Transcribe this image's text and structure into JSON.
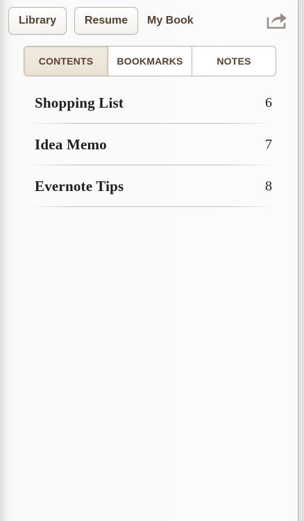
{
  "toolbar": {
    "library_label": "Library",
    "resume_label": "Resume",
    "book_title": "My Book",
    "share_icon": "share-arrow-icon"
  },
  "tabs": [
    {
      "label": "CONTENTS",
      "active": true
    },
    {
      "label": "BOOKMARKS",
      "active": false
    },
    {
      "label": "NOTES",
      "active": false
    }
  ],
  "contents": [
    {
      "title": "Shopping List",
      "page": "6"
    },
    {
      "title": "Idea Memo",
      "page": "7"
    },
    {
      "title": "Evernote Tips",
      "page": "8"
    }
  ],
  "colors": {
    "accent_text": "#5a3f2b",
    "border": "#bcb3a6",
    "active_tab_bg": "#ece5d9"
  }
}
